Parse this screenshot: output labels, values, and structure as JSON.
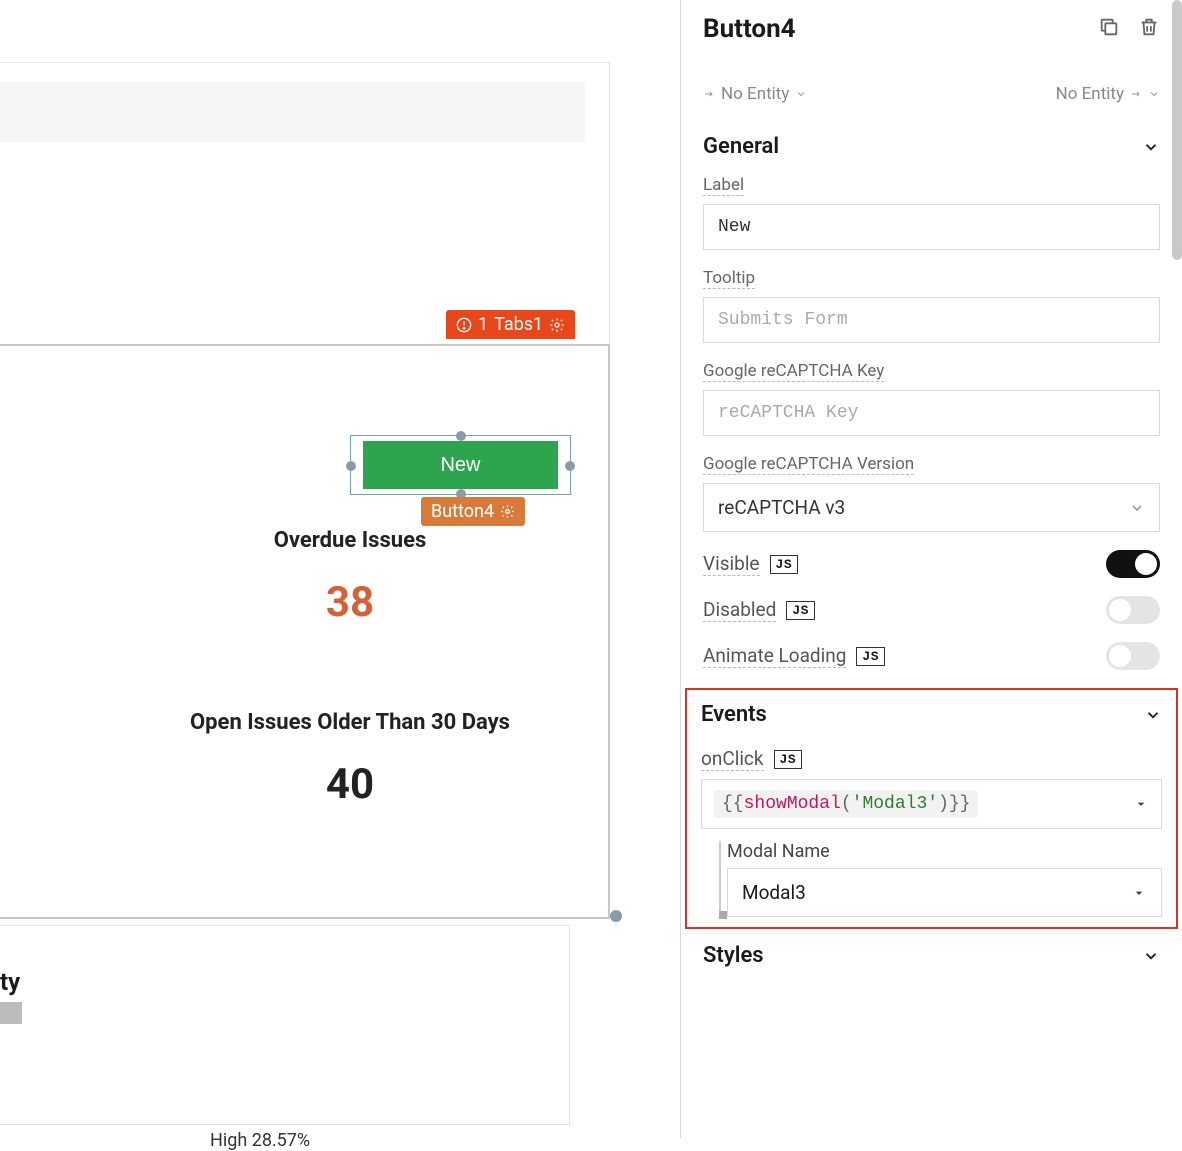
{
  "canvas": {
    "tabs_tag": {
      "count": "1",
      "label": "Tabs1"
    },
    "new_button": {
      "label": "New"
    },
    "button4_tag": "Button4",
    "metric1": {
      "label": "Overdue Issues",
      "value": "38"
    },
    "metric2": {
      "label": "Open Issues Older Than 30 Days",
      "value": "40"
    },
    "ty_fragment": "ty",
    "high_fragment": "High  28.57%"
  },
  "panel": {
    "title": "Button4",
    "entity_left": "No Entity",
    "entity_right": "No Entity",
    "sections": {
      "general": "General",
      "events": "Events",
      "styles": "Styles"
    },
    "fields": {
      "label": {
        "label": "Label",
        "value": "New"
      },
      "tooltip": {
        "label": "Tooltip",
        "placeholder": "Submits Form"
      },
      "recaptcha_key": {
        "label": "Google reCAPTCHA Key",
        "placeholder": "reCAPTCHA Key"
      },
      "recaptcha_version": {
        "label": "Google reCAPTCHA Version",
        "value": "reCAPTCHA v3"
      }
    },
    "toggles": {
      "visible": {
        "label": "Visible",
        "on": true
      },
      "disabled": {
        "label": "Disabled",
        "on": false
      },
      "animate": {
        "label": "Animate Loading",
        "on": false
      }
    },
    "events": {
      "onclick_label": "onClick",
      "code": {
        "open": "{{",
        "fn": "showModal",
        "lp": "(",
        "arg": "'Modal3'",
        "rp": ")",
        "close": "}}"
      },
      "modal_label": "Modal Name",
      "modal_value": "Modal3"
    },
    "js_badge": "JS"
  }
}
